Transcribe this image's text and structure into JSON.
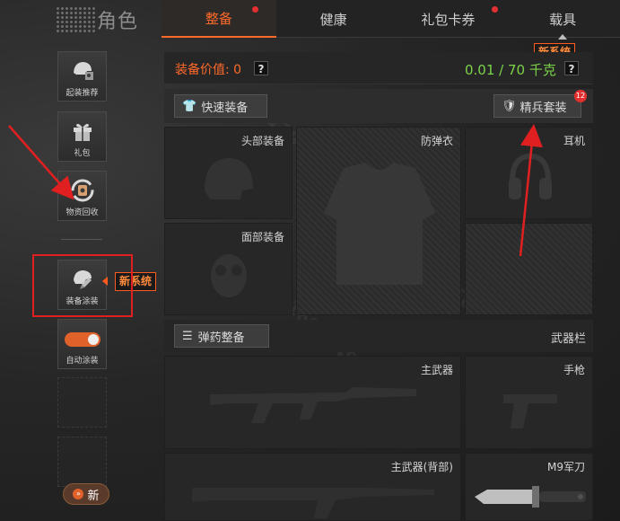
{
  "header": {
    "title": "角色",
    "tabs": [
      {
        "label": "整备",
        "active": true,
        "dot": true
      },
      {
        "label": "健康",
        "active": false,
        "dot": false
      },
      {
        "label": "礼包卡券",
        "active": false,
        "dot": true
      },
      {
        "label": "载具",
        "active": false,
        "dot": false
      }
    ],
    "vehicle_new_tag": "新系统"
  },
  "sidebar": {
    "items": [
      {
        "label": "起装推荐",
        "icon": "helmet-gear-icon"
      },
      {
        "label": "礼包",
        "icon": "gift-icon"
      },
      {
        "label": "物资回收",
        "icon": "recycle-icon"
      },
      {
        "label": "装备涂装",
        "icon": "paint-helmet-icon"
      }
    ],
    "auto_paint": {
      "label": "自动涂装",
      "on": true
    },
    "paint_new_tag": "新系统",
    "new_button": "新"
  },
  "equipment": {
    "value_label": "装备价值: 0",
    "weight": "0.01 / 70 千克",
    "help": "?",
    "quick_equip": "快速装备",
    "elite_set": "精兵套装",
    "elite_badge": "12",
    "slots": {
      "head": "头部装备",
      "armor": "防弹衣",
      "ear": "耳机",
      "face": "面部装备"
    },
    "ammo_button": "弹药整备",
    "weapon_bar": "武器栏",
    "weapons": {
      "primary": "主武器",
      "pistol": "手枪",
      "primary_back": "主武器(背部)",
      "knife": "M9军刀"
    }
  },
  "colors": {
    "accent": "#ff6a2a",
    "weight": "#7bd34a",
    "annotation": "#e02020"
  }
}
